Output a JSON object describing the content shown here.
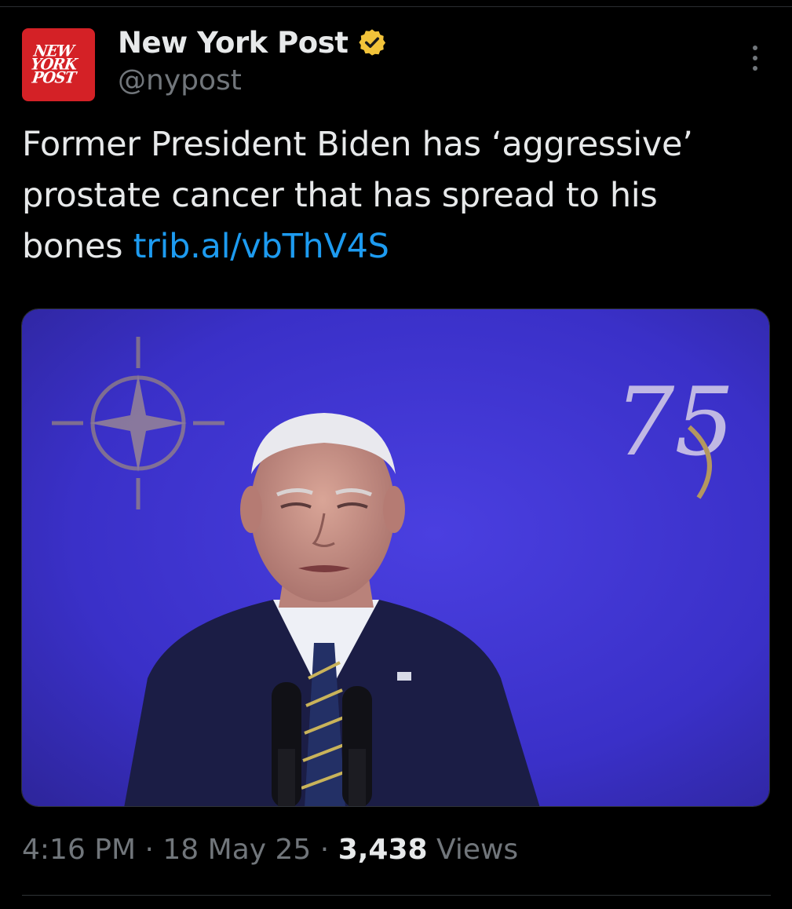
{
  "account": {
    "display_name": "New York Post",
    "handle": "@nypost",
    "verified_badge_icon": "gold-verified-badge-icon",
    "avatar_logo": [
      "NEW",
      "YORK",
      "POST"
    ],
    "avatar_color": "#d42126",
    "badge_color": "#f2c33a"
  },
  "menu": {
    "icon": "more-options-icon"
  },
  "tweet": {
    "text": "Former President Biden has ‘aggressive’ prostate cancer that has spread to his bones ",
    "link": "trib.al/vbThV4S",
    "link_color": "#1d9bf0"
  },
  "media": {
    "background_color": "#3b30c4",
    "logo_left": "nato-compass-icon",
    "logo_right_text": "75"
  },
  "meta": {
    "time": "4:16 PM",
    "separator": " · ",
    "date": "18 May 25",
    "views_count": "3,438",
    "views_label": " Views"
  }
}
